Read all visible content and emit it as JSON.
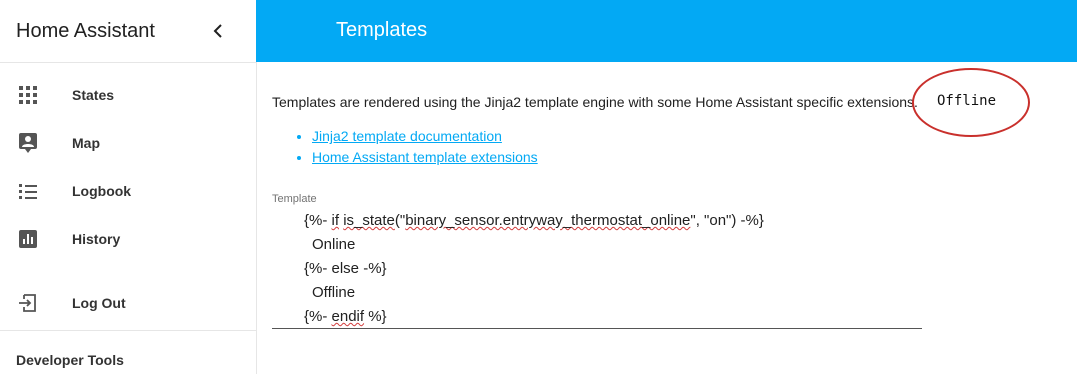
{
  "sidebar": {
    "title": "Home Assistant",
    "collapse_icon": "chevron-left-icon",
    "items": [
      {
        "label": "States",
        "icon": "grid-icon"
      },
      {
        "label": "Map",
        "icon": "account-box-icon"
      },
      {
        "label": "Logbook",
        "icon": "list-icon"
      },
      {
        "label": "History",
        "icon": "chart-icon"
      }
    ],
    "logout": {
      "label": "Log Out",
      "icon": "exit-icon"
    },
    "section": "Developer Tools"
  },
  "toolbar": {
    "title": "Templates",
    "color": "#03a9f4"
  },
  "main": {
    "intro": "Templates are rendered using the Jinja2 template engine with some Home Assistant specific extensions.",
    "result": "Offline",
    "links": [
      "Jinja2 template documentation",
      "Home Assistant template extensions"
    ],
    "template_label": "Template",
    "template_lines": {
      "l1_a": "{%- ",
      "l1_b": "if",
      "l1_c": " ",
      "l1_d": "is_state",
      "l1_e": "(\"",
      "l1_f": "binary_sensor.entryway_thermostat_online",
      "l1_g": "\", \"on\") -%}",
      "l2": "Online",
      "l3": "{%- else -%}",
      "l4": "Offline",
      "l5_a": "{%- ",
      "l5_b": "endif",
      "l5_c": " %}"
    }
  }
}
